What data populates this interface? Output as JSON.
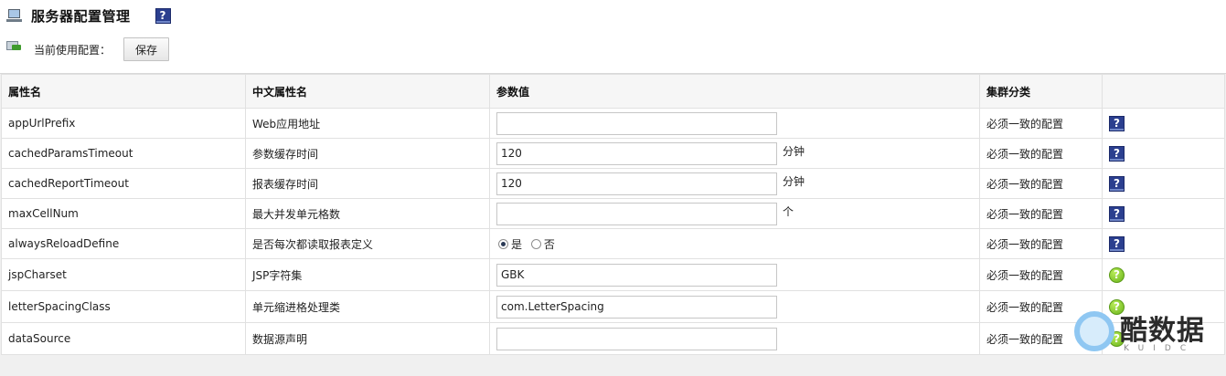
{
  "header": {
    "title": "服务器配置管理",
    "help_glyph": "?"
  },
  "toolbar": {
    "current_label": "当前使用配置：",
    "save_label": "保存"
  },
  "table": {
    "columns": [
      "属性名",
      "中文属性名",
      "参数值",
      "集群分类",
      ""
    ],
    "rows": [
      {
        "name": "appUrlPrefix",
        "cn_name": "Web应用地址",
        "value": "",
        "unit": "",
        "cluster": "必须一致的配置",
        "help": "blue-help-icon"
      },
      {
        "name": "cachedParamsTimeout",
        "cn_name": "参数缓存时间",
        "value": "120",
        "unit": "分钟",
        "cluster": "必须一致的配置",
        "help": "blue-help-icon"
      },
      {
        "name": "cachedReportTimeout",
        "cn_name": "报表缓存时间",
        "value": "120",
        "unit": "分钟",
        "cluster": "必须一致的配置",
        "help": "blue-help-icon"
      },
      {
        "name": "maxCellNum",
        "cn_name": "最大并发单元格数",
        "value": "",
        "unit": "个",
        "cluster": "必须一致的配置",
        "help": "blue-help-icon"
      },
      {
        "name": "alwaysReloadDefine",
        "cn_name": "是否每次都读取报表定义",
        "radio_yes": "是",
        "radio_no": "否",
        "selected": "是",
        "cluster": "必须一致的配置",
        "help": "blue-help-icon"
      },
      {
        "name": "jspCharset",
        "cn_name": "JSP字符集",
        "value": "GBK",
        "unit": "",
        "cluster": "必须一致的配置",
        "help": "green-help-icon"
      },
      {
        "name": "letterSpacingClass",
        "cn_name": "单元缩进格处理类",
        "value": "com.LetterSpacing",
        "unit": "",
        "cluster": "必须一致的配置",
        "help": "green-help-icon"
      },
      {
        "name": "dataSource",
        "cn_name": "数据源声明",
        "value": "",
        "unit": "",
        "cluster": "必须一致的配置",
        "help": "green-help-icon"
      }
    ]
  },
  "watermark": {
    "text": "酷数据",
    "sub": "KUIDC"
  },
  "colors": {
    "header_bg": "#f6f6f6",
    "border": "#e1e1e1",
    "help_blue": "#2b3f8f",
    "help_green": "#6ab41c",
    "panel_bg": "#f0f0f0"
  }
}
